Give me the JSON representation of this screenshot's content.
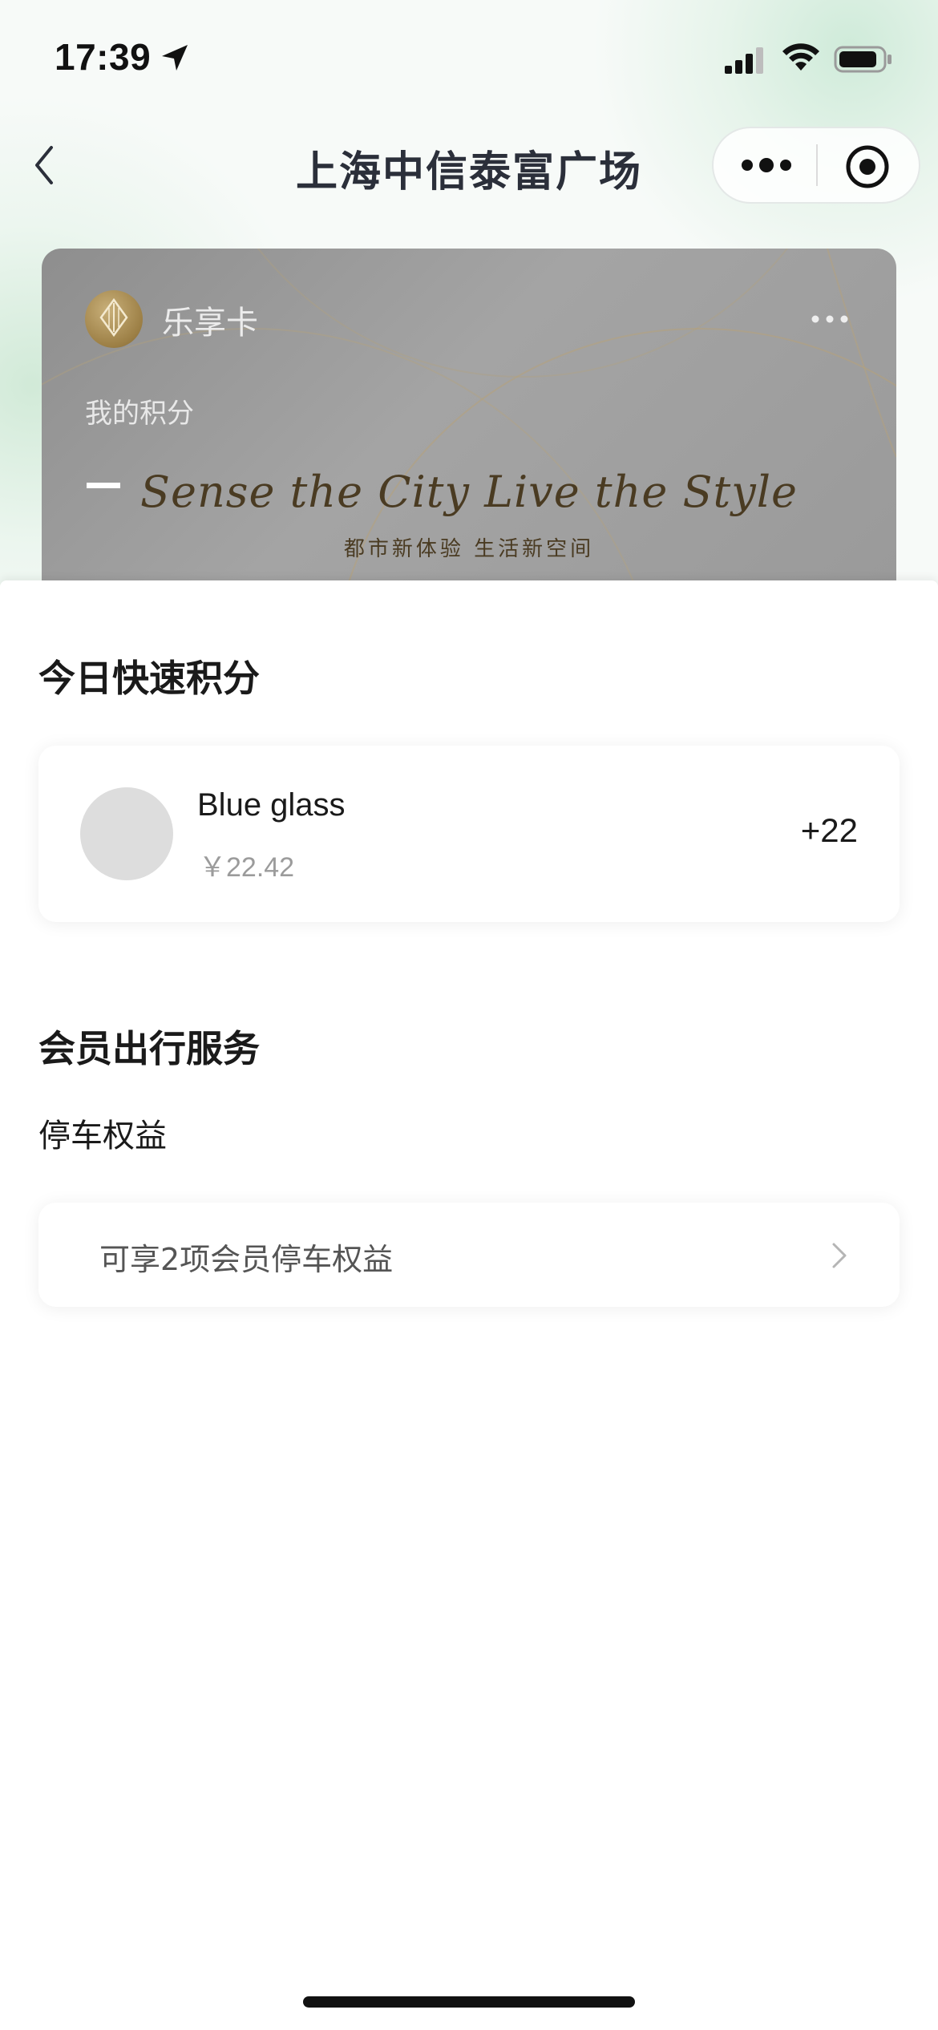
{
  "status_bar": {
    "time": "17:39"
  },
  "nav": {
    "title": "上海中信泰富广场"
  },
  "member_card": {
    "card_name": "乐享卡",
    "points_label": "我的积分",
    "points_value": "—",
    "slogan": "Sense the City Live the Style",
    "slogan_sub": "都市新体验 生活新空间"
  },
  "quick_points": {
    "section_title": "今日快速积分",
    "item": {
      "name": "Blue glass",
      "price": "￥22.42",
      "points": "+22"
    }
  },
  "travel_service": {
    "section_title": "会员出行服务",
    "parking_title": "停车权益",
    "parking_text": "可享2项会员停车权益"
  }
}
